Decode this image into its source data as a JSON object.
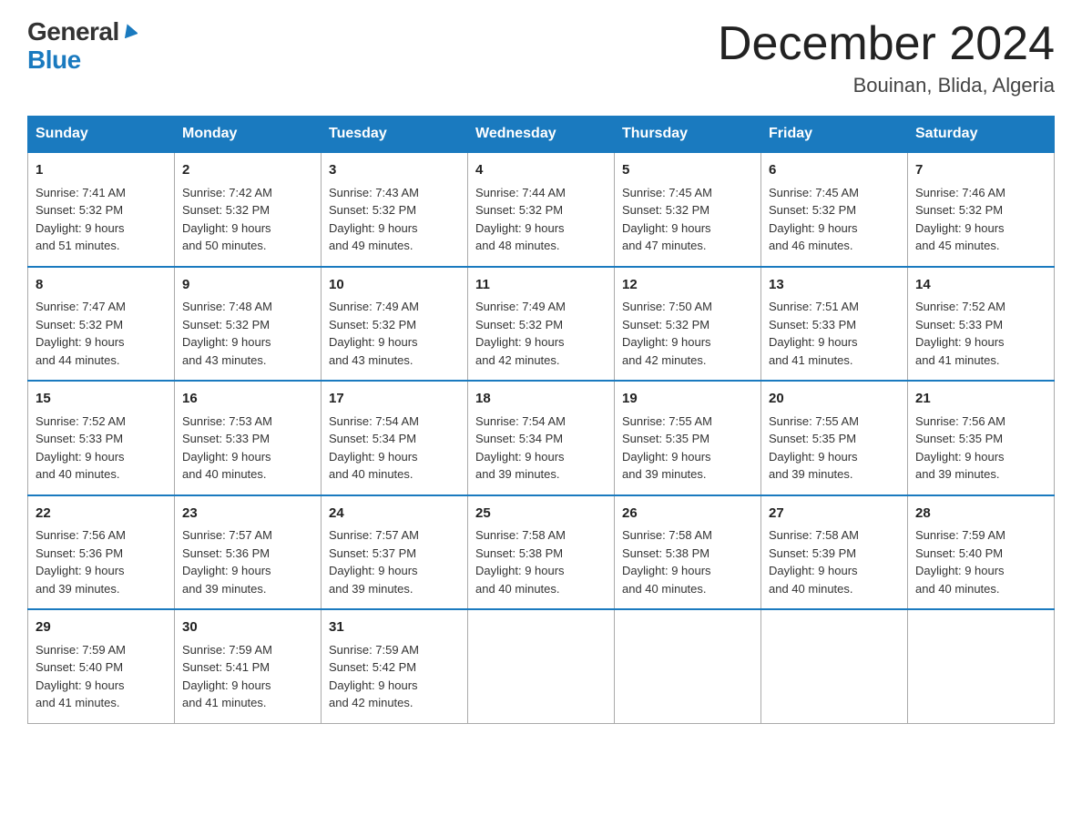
{
  "logo": {
    "general": "General",
    "blue": "Blue"
  },
  "title": "December 2024",
  "location": "Bouinan, Blida, Algeria",
  "days_of_week": [
    "Sunday",
    "Monday",
    "Tuesday",
    "Wednesday",
    "Thursday",
    "Friday",
    "Saturday"
  ],
  "weeks": [
    [
      {
        "day": "1",
        "sunrise": "7:41 AM",
        "sunset": "5:32 PM",
        "daylight": "9 hours and 51 minutes."
      },
      {
        "day": "2",
        "sunrise": "7:42 AM",
        "sunset": "5:32 PM",
        "daylight": "9 hours and 50 minutes."
      },
      {
        "day": "3",
        "sunrise": "7:43 AM",
        "sunset": "5:32 PM",
        "daylight": "9 hours and 49 minutes."
      },
      {
        "day": "4",
        "sunrise": "7:44 AM",
        "sunset": "5:32 PM",
        "daylight": "9 hours and 48 minutes."
      },
      {
        "day": "5",
        "sunrise": "7:45 AM",
        "sunset": "5:32 PM",
        "daylight": "9 hours and 47 minutes."
      },
      {
        "day": "6",
        "sunrise": "7:45 AM",
        "sunset": "5:32 PM",
        "daylight": "9 hours and 46 minutes."
      },
      {
        "day": "7",
        "sunrise": "7:46 AM",
        "sunset": "5:32 PM",
        "daylight": "9 hours and 45 minutes."
      }
    ],
    [
      {
        "day": "8",
        "sunrise": "7:47 AM",
        "sunset": "5:32 PM",
        "daylight": "9 hours and 44 minutes."
      },
      {
        "day": "9",
        "sunrise": "7:48 AM",
        "sunset": "5:32 PM",
        "daylight": "9 hours and 43 minutes."
      },
      {
        "day": "10",
        "sunrise": "7:49 AM",
        "sunset": "5:32 PM",
        "daylight": "9 hours and 43 minutes."
      },
      {
        "day": "11",
        "sunrise": "7:49 AM",
        "sunset": "5:32 PM",
        "daylight": "9 hours and 42 minutes."
      },
      {
        "day": "12",
        "sunrise": "7:50 AM",
        "sunset": "5:32 PM",
        "daylight": "9 hours and 42 minutes."
      },
      {
        "day": "13",
        "sunrise": "7:51 AM",
        "sunset": "5:33 PM",
        "daylight": "9 hours and 41 minutes."
      },
      {
        "day": "14",
        "sunrise": "7:52 AM",
        "sunset": "5:33 PM",
        "daylight": "9 hours and 41 minutes."
      }
    ],
    [
      {
        "day": "15",
        "sunrise": "7:52 AM",
        "sunset": "5:33 PM",
        "daylight": "9 hours and 40 minutes."
      },
      {
        "day": "16",
        "sunrise": "7:53 AM",
        "sunset": "5:33 PM",
        "daylight": "9 hours and 40 minutes."
      },
      {
        "day": "17",
        "sunrise": "7:54 AM",
        "sunset": "5:34 PM",
        "daylight": "9 hours and 40 minutes."
      },
      {
        "day": "18",
        "sunrise": "7:54 AM",
        "sunset": "5:34 PM",
        "daylight": "9 hours and 39 minutes."
      },
      {
        "day": "19",
        "sunrise": "7:55 AM",
        "sunset": "5:35 PM",
        "daylight": "9 hours and 39 minutes."
      },
      {
        "day": "20",
        "sunrise": "7:55 AM",
        "sunset": "5:35 PM",
        "daylight": "9 hours and 39 minutes."
      },
      {
        "day": "21",
        "sunrise": "7:56 AM",
        "sunset": "5:35 PM",
        "daylight": "9 hours and 39 minutes."
      }
    ],
    [
      {
        "day": "22",
        "sunrise": "7:56 AM",
        "sunset": "5:36 PM",
        "daylight": "9 hours and 39 minutes."
      },
      {
        "day": "23",
        "sunrise": "7:57 AM",
        "sunset": "5:36 PM",
        "daylight": "9 hours and 39 minutes."
      },
      {
        "day": "24",
        "sunrise": "7:57 AM",
        "sunset": "5:37 PM",
        "daylight": "9 hours and 39 minutes."
      },
      {
        "day": "25",
        "sunrise": "7:58 AM",
        "sunset": "5:38 PM",
        "daylight": "9 hours and 40 minutes."
      },
      {
        "day": "26",
        "sunrise": "7:58 AM",
        "sunset": "5:38 PM",
        "daylight": "9 hours and 40 minutes."
      },
      {
        "day": "27",
        "sunrise": "7:58 AM",
        "sunset": "5:39 PM",
        "daylight": "9 hours and 40 minutes."
      },
      {
        "day": "28",
        "sunrise": "7:59 AM",
        "sunset": "5:40 PM",
        "daylight": "9 hours and 40 minutes."
      }
    ],
    [
      {
        "day": "29",
        "sunrise": "7:59 AM",
        "sunset": "5:40 PM",
        "daylight": "9 hours and 41 minutes."
      },
      {
        "day": "30",
        "sunrise": "7:59 AM",
        "sunset": "5:41 PM",
        "daylight": "9 hours and 41 minutes."
      },
      {
        "day": "31",
        "sunrise": "7:59 AM",
        "sunset": "5:42 PM",
        "daylight": "9 hours and 42 minutes."
      },
      null,
      null,
      null,
      null
    ]
  ],
  "labels": {
    "sunrise": "Sunrise:",
    "sunset": "Sunset:",
    "daylight": "Daylight:"
  }
}
